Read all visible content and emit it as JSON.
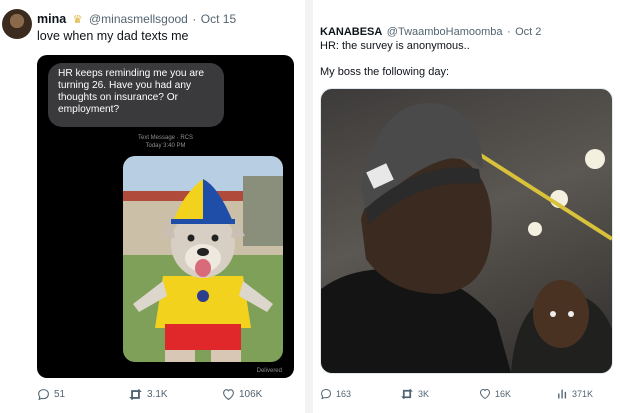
{
  "tweets": [
    {
      "display_name": "mina",
      "handle": "@minasmellsgood",
      "separator": "·",
      "date": "Oct 15",
      "text": "love when my dad texts me",
      "media": {
        "imessage_bubble_lines": [
          "HR keeps reminding me you are",
          "turning 26.  Have you had any",
          "thoughts on insurance?  Or",
          "employment?"
        ],
        "meta_line1": "Text Message · RCS",
        "meta_line2": "Today 3:40 PM",
        "status": "Delivered"
      },
      "stats": {
        "replies": "51",
        "retweets": "3.1K",
        "likes": "106K"
      }
    },
    {
      "display_name": "KANABESA",
      "handle": "@TwaamboHamoomba",
      "separator": "·",
      "date": "Oct 2",
      "text_line1": "HR: the survey is anonymous..",
      "text_line2": "My boss the following day:",
      "stats": {
        "replies": "163",
        "retweets": "3K",
        "likes": "16K",
        "views": "371K"
      }
    }
  ],
  "colors": {
    "secondary_text": "#536471",
    "background": "#ffffff",
    "divider": "#f3f3f3"
  }
}
